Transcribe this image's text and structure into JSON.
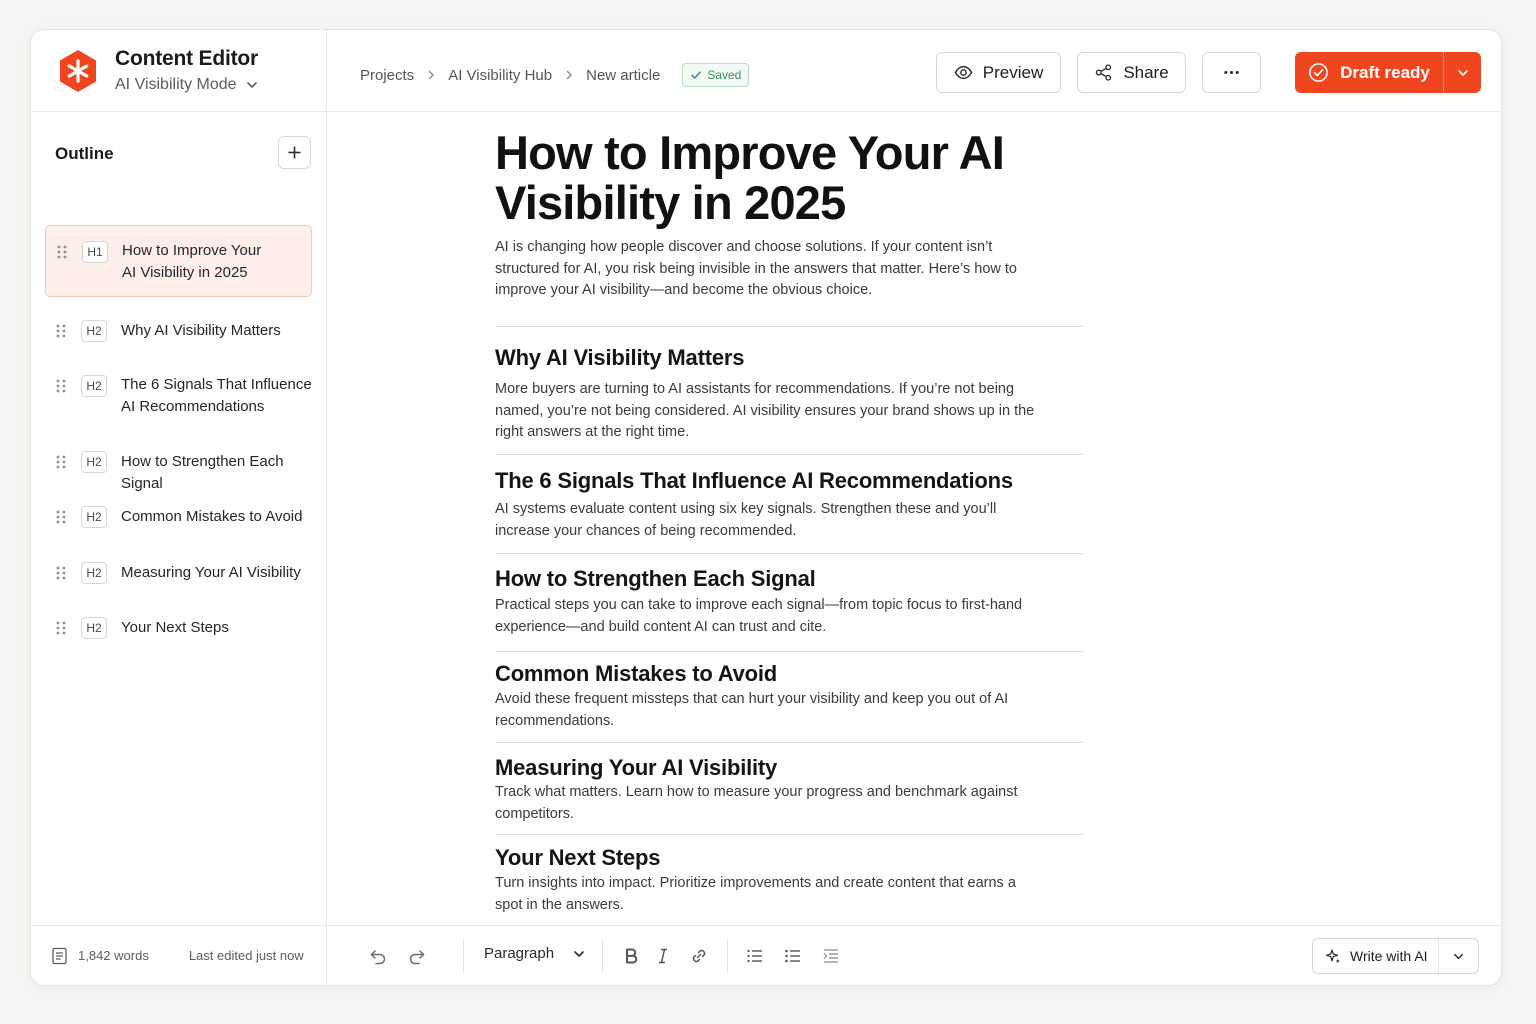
{
  "app": {
    "title": "Content Editor",
    "mode": "AI Visibility Mode",
    "logo_icon": "asterisk-logo",
    "accent_color": "#f0461f"
  },
  "breadcrumb": [
    "Projects",
    "AI Visibility Hub",
    "New article"
  ],
  "saved_badge": "Saved",
  "header_buttons": {
    "preview": "Preview",
    "share": "Share",
    "draft_ready": "Draft ready"
  },
  "outline": {
    "title": "Outline",
    "items": [
      {
        "level": "H1",
        "label": "How to Improve Your\nAI Visibility in 2025",
        "active": true
      },
      {
        "level": "H2",
        "label": "Why AI Visibility Matters"
      },
      {
        "level": "H2",
        "label": "The 6 Signals That Influence\nAI Recommendations"
      },
      {
        "level": "H2",
        "label": "How to Strengthen Each Signal"
      },
      {
        "level": "H2",
        "label": "Common Mistakes to Avoid"
      },
      {
        "level": "H2",
        "label": "Measuring Your AI Visibility"
      },
      {
        "level": "H2",
        "label": "Your Next Steps"
      }
    ]
  },
  "document": {
    "title": "How to Improve Your AI Visibility in 2025",
    "intro": "AI is changing how people discover and choose solutions. If your content isn’t structured for AI, you risk being invisible in the answers that matter. Here’s how to improve your AI visibility—and become the obvious choice.",
    "sections": [
      {
        "heading": "Why AI Visibility Matters",
        "body": "More buyers are turning to AI assistants for recommendations. If you’re not being named, you’re not being considered. AI visibility ensures your brand shows up in the right answers at the right time."
      },
      {
        "heading": "The 6 Signals That Influence AI Recommendations",
        "body": "AI systems evaluate content using six key signals. Strengthen these and you’ll increase your chances of being recommended."
      },
      {
        "heading": "How to Strengthen Each Signal",
        "body": "Practical steps you can take to improve each signal—from topic focus to first-hand experience—and build content AI can trust and cite."
      },
      {
        "heading": "Common Mistakes to Avoid",
        "body": "Avoid these frequent missteps that can hurt your visibility and keep you out of AI recommendations."
      },
      {
        "heading": "Measuring Your AI Visibility",
        "body": "Track what matters. Learn how to measure your progress and benchmark against competitors."
      },
      {
        "heading": "Your Next Steps",
        "body": "Turn insights into impact. Prioritize improvements and create content that earns a spot in the answers."
      }
    ]
  },
  "footer": {
    "word_count": "1,842 words",
    "last_edited": "Last edited just now"
  },
  "toolbar": {
    "block_type": "Paragraph",
    "write_ai": "Write with AI"
  }
}
